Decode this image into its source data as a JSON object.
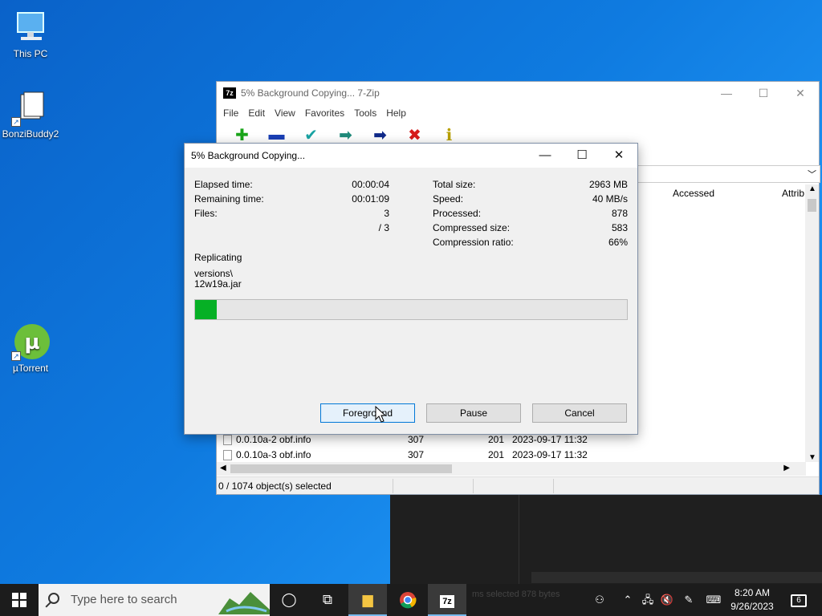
{
  "desktop": {
    "icons": [
      {
        "label": "This PC"
      },
      {
        "label": "BonziBuddy2"
      },
      {
        "label": "µTorrent"
      }
    ]
  },
  "main_window": {
    "title": "5% Background Copying... 7-Zip",
    "logo_text": "7z",
    "menu": [
      "File",
      "Edit",
      "View",
      "Favorites",
      "Tools",
      "Help"
    ],
    "toolbar": [
      "add-icon",
      "extract-icon",
      "test-icon",
      "copy-icon",
      "move-icon",
      "delete-icon",
      "info-icon"
    ],
    "columns": {
      "accessed": "Accessed",
      "attrib": "Attrib"
    },
    "rows": [
      {
        "name": "0.0.10a-2 obf.info",
        "size": "307",
        "packed": "201",
        "modified": "2023-09-17 11:32"
      },
      {
        "name": "0.0.10a-3 obf.info",
        "size": "307",
        "packed": "201",
        "modified": "2023-09-17 11:32"
      }
    ],
    "status": "0 / 1074 object(s) selected"
  },
  "dialog": {
    "title": "5% Background Copying...",
    "stats_left": [
      {
        "label": "Elapsed time:",
        "value": "00:00:04"
      },
      {
        "label": "Remaining time:",
        "value": "00:01:09"
      },
      {
        "label": "Files:",
        "value": "3"
      },
      {
        "label": "",
        "value": "/ 3"
      }
    ],
    "stats_right": [
      {
        "label": "Total size:",
        "value": "2963 MB"
      },
      {
        "label": "Speed:",
        "value": "40 MB/s"
      },
      {
        "label": "Processed:",
        "value": "878"
      },
      {
        "label": "Compressed size:",
        "value": "583"
      },
      {
        "label": "Compression ratio:",
        "value": "66%"
      }
    ],
    "operation": "Replicating",
    "path_line1": "versions\\",
    "path_line2": "12w19a.jar",
    "progress_fraction": 0.05,
    "progress_color": "#06b025",
    "buttons": {
      "foreground": "Foreground",
      "pause": "Pause",
      "cancel": "Cancel"
    }
  },
  "taskbar": {
    "search_placeholder": "Type here to search",
    "time": "8:20 AM",
    "date": "9/26/2023",
    "notification_count": "6",
    "ghost_text": "ms selected 878 bytes"
  }
}
